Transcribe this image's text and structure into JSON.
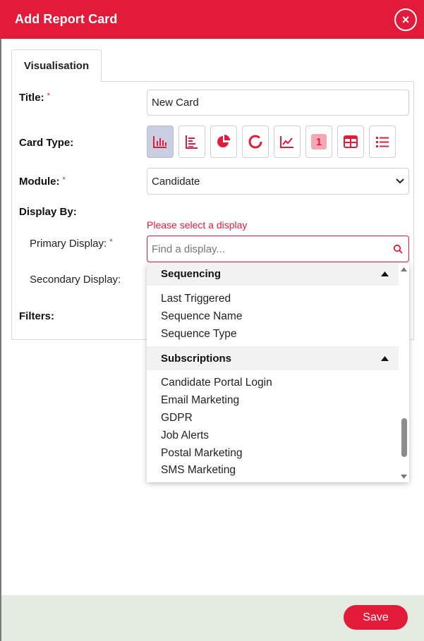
{
  "header": {
    "title": "Add Report Card",
    "close_label": "×"
  },
  "tabs": [
    {
      "label": "Visualisation"
    }
  ],
  "form": {
    "title_label": "Title:",
    "title_value": "New Card",
    "card_type_label": "Card Type:",
    "module_label": "Module:",
    "module_value": "Candidate",
    "display_by_label": "Display By:",
    "primary_display_label": "Primary Display:",
    "secondary_display_label": "Secondary Display:",
    "filters_label": "Filters:",
    "required_mark": "*",
    "error_text": "Please select a display",
    "search_placeholder": "Find a display..."
  },
  "card_types": [
    {
      "icon": "bar-chart-icon",
      "active": true
    },
    {
      "icon": "horizontal-bar-icon",
      "active": false
    },
    {
      "icon": "pie-chart-icon",
      "active": false
    },
    {
      "icon": "donut-chart-icon",
      "active": false
    },
    {
      "icon": "line-chart-icon",
      "active": false
    },
    {
      "icon": "number-icon",
      "active": false,
      "text": "1"
    },
    {
      "icon": "table-icon",
      "active": false
    },
    {
      "icon": "list-icon",
      "active": false
    }
  ],
  "dropdown": {
    "groups": [
      {
        "name": "Sequencing",
        "items": [
          "Last Triggered",
          "Sequence Name",
          "Sequence Type"
        ]
      },
      {
        "name": "Subscriptions",
        "items": [
          "Candidate Portal Login",
          "Email Marketing",
          "GDPR",
          "Job Alerts",
          "Postal Marketing",
          "SMS Marketing"
        ]
      }
    ]
  },
  "footer": {
    "save_label": "Save"
  },
  "colors": {
    "accent": "#e31b3b",
    "active_icon_bg": "#c9cfe0",
    "footer_bg": "#e4ebe0"
  }
}
